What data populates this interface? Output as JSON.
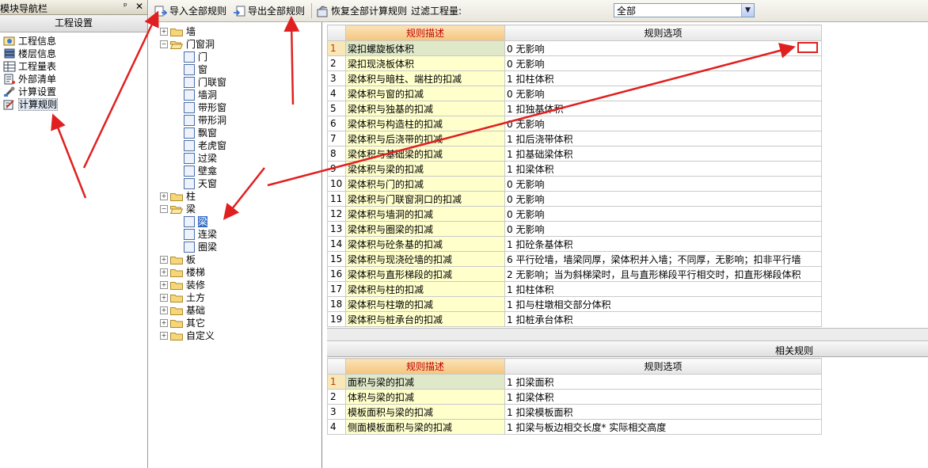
{
  "nav": {
    "title": "模块导航栏",
    "pin": "ᵖ",
    "close": "✕",
    "group_label": "工程设置",
    "items": [
      {
        "label": "工程信息",
        "icon": "project-info-icon"
      },
      {
        "label": "楼层信息",
        "icon": "floor-info-icon"
      },
      {
        "label": "工程量表",
        "icon": "quantity-table-icon"
      },
      {
        "label": "外部清单",
        "icon": "external-list-icon"
      },
      {
        "label": "计算设置",
        "icon": "calc-settings-icon"
      },
      {
        "label": "计算规则",
        "icon": "calc-rules-icon"
      }
    ]
  },
  "toolbar": {
    "import_label": "导入全部规则",
    "export_label": "导出全部规则",
    "restore_label": "恢复全部计算规则",
    "filter_label": "过滤工程量:",
    "filter_value": "全部"
  },
  "tree": {
    "nodes": [
      {
        "label": "墙",
        "level": 0,
        "expander": "+",
        "kind": "folder"
      },
      {
        "label": "门窗洞",
        "level": 0,
        "expander": "−",
        "kind": "folder-open"
      },
      {
        "label": "门",
        "level": 1,
        "kind": "leaf"
      },
      {
        "label": "窗",
        "level": 1,
        "kind": "leaf"
      },
      {
        "label": "门联窗",
        "level": 1,
        "kind": "leaf"
      },
      {
        "label": "墙洞",
        "level": 1,
        "kind": "leaf"
      },
      {
        "label": "带形窗",
        "level": 1,
        "kind": "leaf"
      },
      {
        "label": "带形洞",
        "level": 1,
        "kind": "leaf"
      },
      {
        "label": "飘窗",
        "level": 1,
        "kind": "leaf"
      },
      {
        "label": "老虎窗",
        "level": 1,
        "kind": "leaf"
      },
      {
        "label": "过梁",
        "level": 1,
        "kind": "leaf"
      },
      {
        "label": "壁龛",
        "level": 1,
        "kind": "leaf"
      },
      {
        "label": "天窗",
        "level": 1,
        "kind": "leaf"
      },
      {
        "label": "柱",
        "level": 0,
        "expander": "+",
        "kind": "folder"
      },
      {
        "label": "梁",
        "level": 0,
        "expander": "−",
        "kind": "folder-open"
      },
      {
        "label": "梁",
        "level": 1,
        "kind": "leaf",
        "selected": true
      },
      {
        "label": "连梁",
        "level": 1,
        "kind": "leaf"
      },
      {
        "label": "圈梁",
        "level": 1,
        "kind": "leaf"
      },
      {
        "label": "板",
        "level": 0,
        "expander": "+",
        "kind": "folder"
      },
      {
        "label": "楼梯",
        "level": 0,
        "expander": "+",
        "kind": "folder"
      },
      {
        "label": "装修",
        "level": 0,
        "expander": "+",
        "kind": "folder"
      },
      {
        "label": "土方",
        "level": 0,
        "expander": "+",
        "kind": "folder"
      },
      {
        "label": "基础",
        "level": 0,
        "expander": "+",
        "kind": "folder"
      },
      {
        "label": "其它",
        "level": 0,
        "expander": "+",
        "kind": "folder"
      },
      {
        "label": "自定义",
        "level": 0,
        "expander": "+",
        "kind": "folder"
      }
    ]
  },
  "rules_table": {
    "col_desc": "规则描述",
    "col_option": "规则选项",
    "rows": [
      {
        "n": "1",
        "desc": "梁扣螺旋板体积",
        "opt": "0  无影响"
      },
      {
        "n": "2",
        "desc": "梁扣现浇板体积",
        "opt": "0  无影响"
      },
      {
        "n": "3",
        "desc": "梁体积与暗柱、端柱的扣减",
        "opt": "1 扣柱体积"
      },
      {
        "n": "4",
        "desc": "梁体积与窗的扣减",
        "opt": "0  无影响"
      },
      {
        "n": "5",
        "desc": "梁体积与独基的扣减",
        "opt": "1 扣独基体积"
      },
      {
        "n": "6",
        "desc": "梁体积与构造柱的扣减",
        "opt": "0  无影响"
      },
      {
        "n": "7",
        "desc": "梁体积与后浇带的扣减",
        "opt": "1 扣后浇带体积"
      },
      {
        "n": "8",
        "desc": "梁体积与基础梁的扣减",
        "opt": "1 扣基础梁体积"
      },
      {
        "n": "9",
        "desc": "梁体积与梁的扣减",
        "opt": "1 扣梁体积"
      },
      {
        "n": "10",
        "desc": "梁体积与门的扣减",
        "opt": "0  无影响"
      },
      {
        "n": "11",
        "desc": "梁体积与门联窗洞口的扣减",
        "opt": "0  无影响"
      },
      {
        "n": "12",
        "desc": "梁体积与墙洞的扣减",
        "opt": "0  无影响"
      },
      {
        "n": "13",
        "desc": "梁体积与圈梁的扣减",
        "opt": "0  无影响"
      },
      {
        "n": "14",
        "desc": "梁体积与砼条基的扣减",
        "opt": "1 扣砼条基体积"
      },
      {
        "n": "15",
        "desc": "梁体积与现浇砼墙的扣减",
        "opt": "6 平行砼墙，墙梁同厚，梁体积并入墙；不同厚，无影响；扣非平行墙"
      },
      {
        "n": "16",
        "desc": "梁体积与直形梯段的扣减",
        "opt": "2 无影响；当为斜梯梁时，且与直形梯段平行相交时，扣直形梯段体积"
      },
      {
        "n": "17",
        "desc": "梁体积与柱的扣减",
        "opt": "1 扣柱体积"
      },
      {
        "n": "18",
        "desc": "梁体积与柱墩的扣减",
        "opt": "1 扣与柱墩相交部分体积"
      },
      {
        "n": "19",
        "desc": "梁体积与桩承台的扣减",
        "opt": "1 扣桩承台体积"
      }
    ]
  },
  "related": {
    "title": "相关规则",
    "col_desc": "规则描述",
    "col_option": "规则选项",
    "rows": [
      {
        "n": "1",
        "desc": "面积与梁的扣减",
        "opt": "1 扣梁面积"
      },
      {
        "n": "2",
        "desc": "体积与梁的扣减",
        "opt": "1 扣梁体积"
      },
      {
        "n": "3",
        "desc": "模板面积与梁的扣减",
        "opt": "1 扣梁模板面积"
      },
      {
        "n": "4",
        "desc": "侧面模板面积与梁的扣减",
        "opt": "1 扣梁与板边相交长度* 实际相交高度"
      }
    ]
  },
  "colors": {
    "annotation_red": "#e02020",
    "header_desc_text": "#c00000",
    "desc_cell_bg": "#ffffcc",
    "tree_selection": "#316ac5"
  }
}
